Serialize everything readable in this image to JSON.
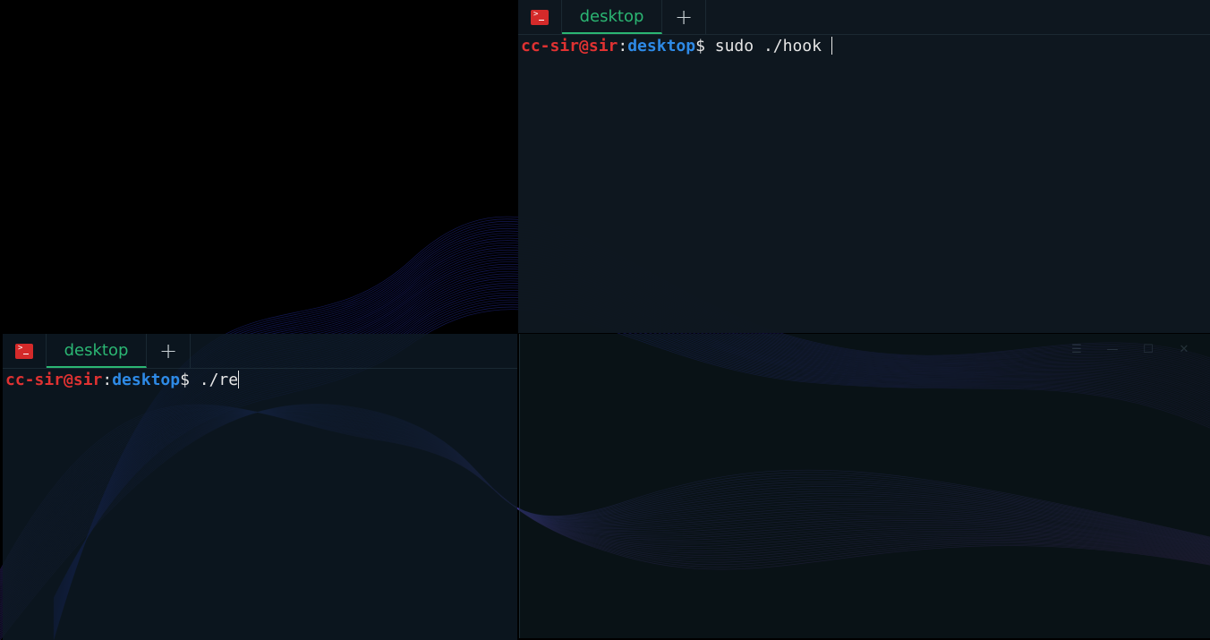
{
  "terminals": {
    "top": {
      "tab_label": "desktop",
      "new_tab_symbol": "+",
      "prompt": {
        "user_host": "cc-sir@sir",
        "colon": ":",
        "dir": "desktop",
        "dollar": "$"
      },
      "command": " sudo ./hook "
    },
    "bottom": {
      "tab_label": "desktop",
      "new_tab_symbol": "+",
      "prompt": {
        "user_host": "cc-sir@sir",
        "colon": ":",
        "dir": "desktop",
        "dollar": "$"
      },
      "command": " ./re"
    },
    "empty": {
      "controls": {
        "menu": "☰",
        "minimize": "—",
        "maximize": "☐",
        "close": "✕"
      }
    }
  },
  "icons": {
    "terminal_app": "terminal-icon",
    "new_tab": "plus-icon"
  },
  "colors": {
    "prompt_user": "#e03232",
    "prompt_dir": "#2e8ae6",
    "active_tab": "#2bb673",
    "terminal_icon_bg": "#d42a2a"
  }
}
